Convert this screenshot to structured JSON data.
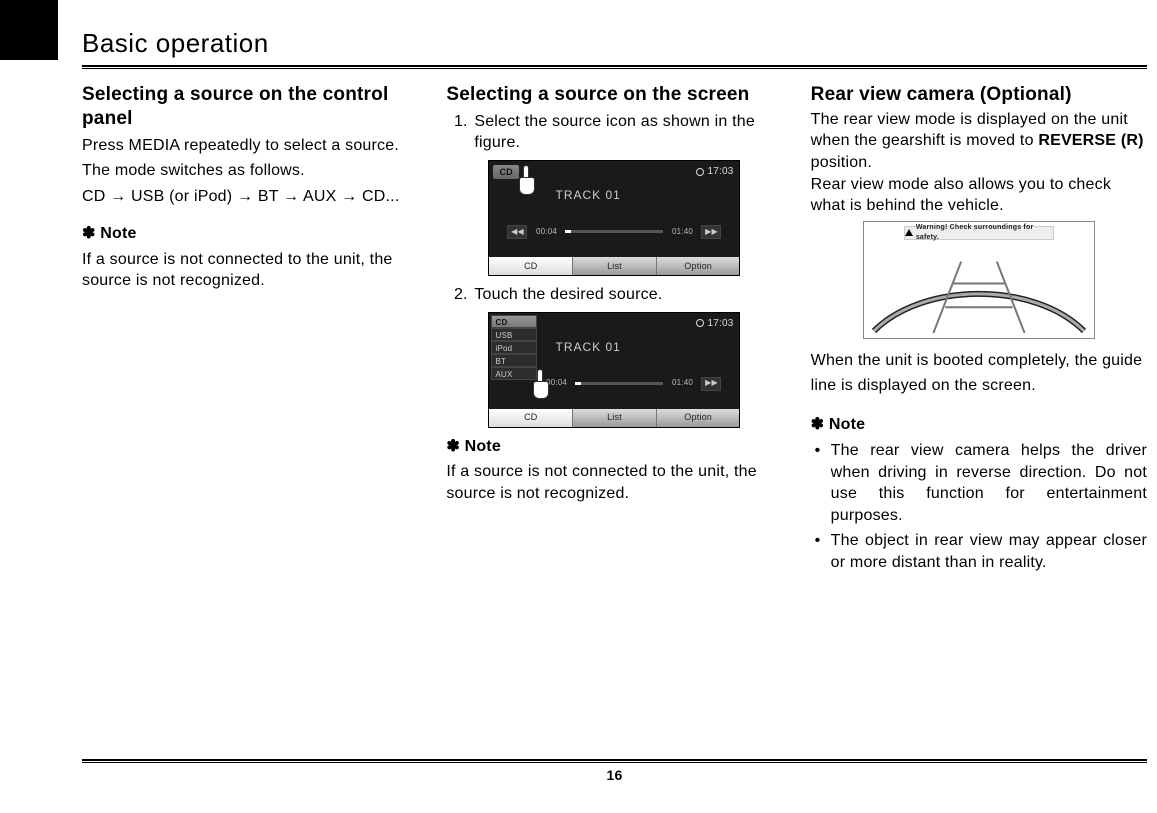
{
  "chapter": "Basic operation",
  "page_number": "16",
  "col1": {
    "heading": "Selecting a source on the control panel",
    "p1": "Press MEDIA repeatedly to select a source.",
    "p2": "The mode switches as follows.",
    "seq_prefix": "CD ",
    "seq_items": [
      "USB (or iPod)",
      "BT",
      "AUX",
      "CD..."
    ],
    "note_label": "✽ Note",
    "note_body": "If a source is not connected to the unit, the source is not recognized."
  },
  "col2": {
    "heading": "Selecting a source on the screen",
    "step1": "Select the source icon as shown in the figure.",
    "step2": "Touch the desired source.",
    "note_label": "✽ Note",
    "note_body": "If a source is not connected to the unit, the source is not recognized.",
    "shot": {
      "badge": "CD",
      "clock": "17:03",
      "track": "TRACK 01",
      "t_elapsed": "00:04",
      "t_total": "01:40",
      "tab_cd": "CD",
      "tab_list": "List",
      "tab_option": "Option",
      "sources": [
        "CD",
        "USB",
        "iPod",
        "BT",
        "AUX"
      ]
    }
  },
  "col3": {
    "heading": "Rear view camera (Optional)",
    "p1a": "The rear view mode is displayed on the unit when the gearshift is moved to ",
    "p1b_strong": "REVERSE (R)",
    "p1c": " position.",
    "p2": "Rear view mode also allows you to check what is behind the vehicle.",
    "warn_text": "Warning! Check surroundings for safety.",
    "p3": "When the unit is booted completely, the guide line is displayed on the screen.",
    "note_label": "✽ Note",
    "bullets": [
      "The rear view camera helps the driver when driving in reverse direction. Do not use this function for entertainment purposes.",
      "The object in rear view may appear closer or more distant than in reality."
    ]
  }
}
